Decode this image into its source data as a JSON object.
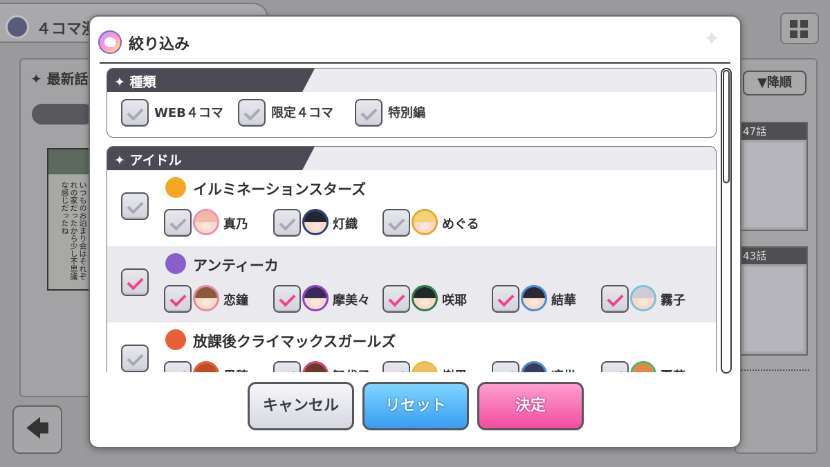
{
  "background": {
    "tab_title": "４コマ漫",
    "left_panel_title": "✦ 最新話",
    "sort_label": "▼降順",
    "episodes": [
      "47話",
      "43話"
    ],
    "comic_text": "いつものお泊まり会はそれぞれの家だったから少し不思議な感じだったね",
    "back_icon": "arrow-left-icon"
  },
  "modal": {
    "title": "絞り込み",
    "sections": {
      "type": {
        "label": "種類",
        "options": [
          {
            "label": "WEB４コマ",
            "checked": false
          },
          {
            "label": "限定４コマ",
            "checked": false
          },
          {
            "label": "特別編",
            "checked": false
          }
        ]
      },
      "idol": {
        "label": "アイドル",
        "groups": [
          {
            "name": "イルミネーションスターズ",
            "checked": false,
            "icon_color": "#f5a623",
            "members": [
              {
                "name": "真乃",
                "checked": false,
                "hair": "#f3b8a6",
                "ring": "#f08db5"
              },
              {
                "name": "灯織",
                "checked": false,
                "hair": "#232530",
                "ring": "#2e3d78"
              },
              {
                "name": "めぐる",
                "checked": false,
                "hair": "#f1d37a",
                "ring": "#e5a82a"
              }
            ]
          },
          {
            "name": "アンティーカ",
            "checked": true,
            "icon_color": "#8a5fc8",
            "members": [
              {
                "name": "恋鐘",
                "checked": true,
                "hair": "#8a5a3a",
                "ring": "#e08aa3"
              },
              {
                "name": "摩美々",
                "checked": true,
                "hair": "#3a2a5a",
                "ring": "#8e3fc9"
              },
              {
                "name": "咲耶",
                "checked": true,
                "hair": "#1f2a2a",
                "ring": "#2f7a4a"
              },
              {
                "name": "結華",
                "checked": true,
                "hair": "#2a2a30",
                "ring": "#4a8ad8"
              },
              {
                "name": "霧子",
                "checked": true,
                "hair": "#d0ccd6",
                "ring": "#78c0e0"
              }
            ]
          },
          {
            "name": "放課後クライマックスガールズ",
            "checked": false,
            "icon_color": "#e8603a",
            "members": [
              {
                "name": "果穂",
                "checked": false,
                "hair": "#c24a2a",
                "ring": "#e0603a"
              },
              {
                "name": "智代子",
                "checked": false,
                "hair": "#6a3a2a",
                "ring": "#d04a7a"
              },
              {
                "name": "樹里",
                "checked": false,
                "hair": "#f0c060",
                "ring": "#e0c040"
              },
              {
                "name": "凛世",
                "checked": false,
                "hair": "#3a3a5a",
                "ring": "#4a8ad8"
              },
              {
                "name": "夏葉",
                "checked": false,
                "hair": "#e08a4a",
                "ring": "#4ab06a"
              }
            ]
          }
        ]
      }
    },
    "buttons": {
      "cancel": "キャンセル",
      "reset": "リセット",
      "ok": "決定"
    }
  }
}
